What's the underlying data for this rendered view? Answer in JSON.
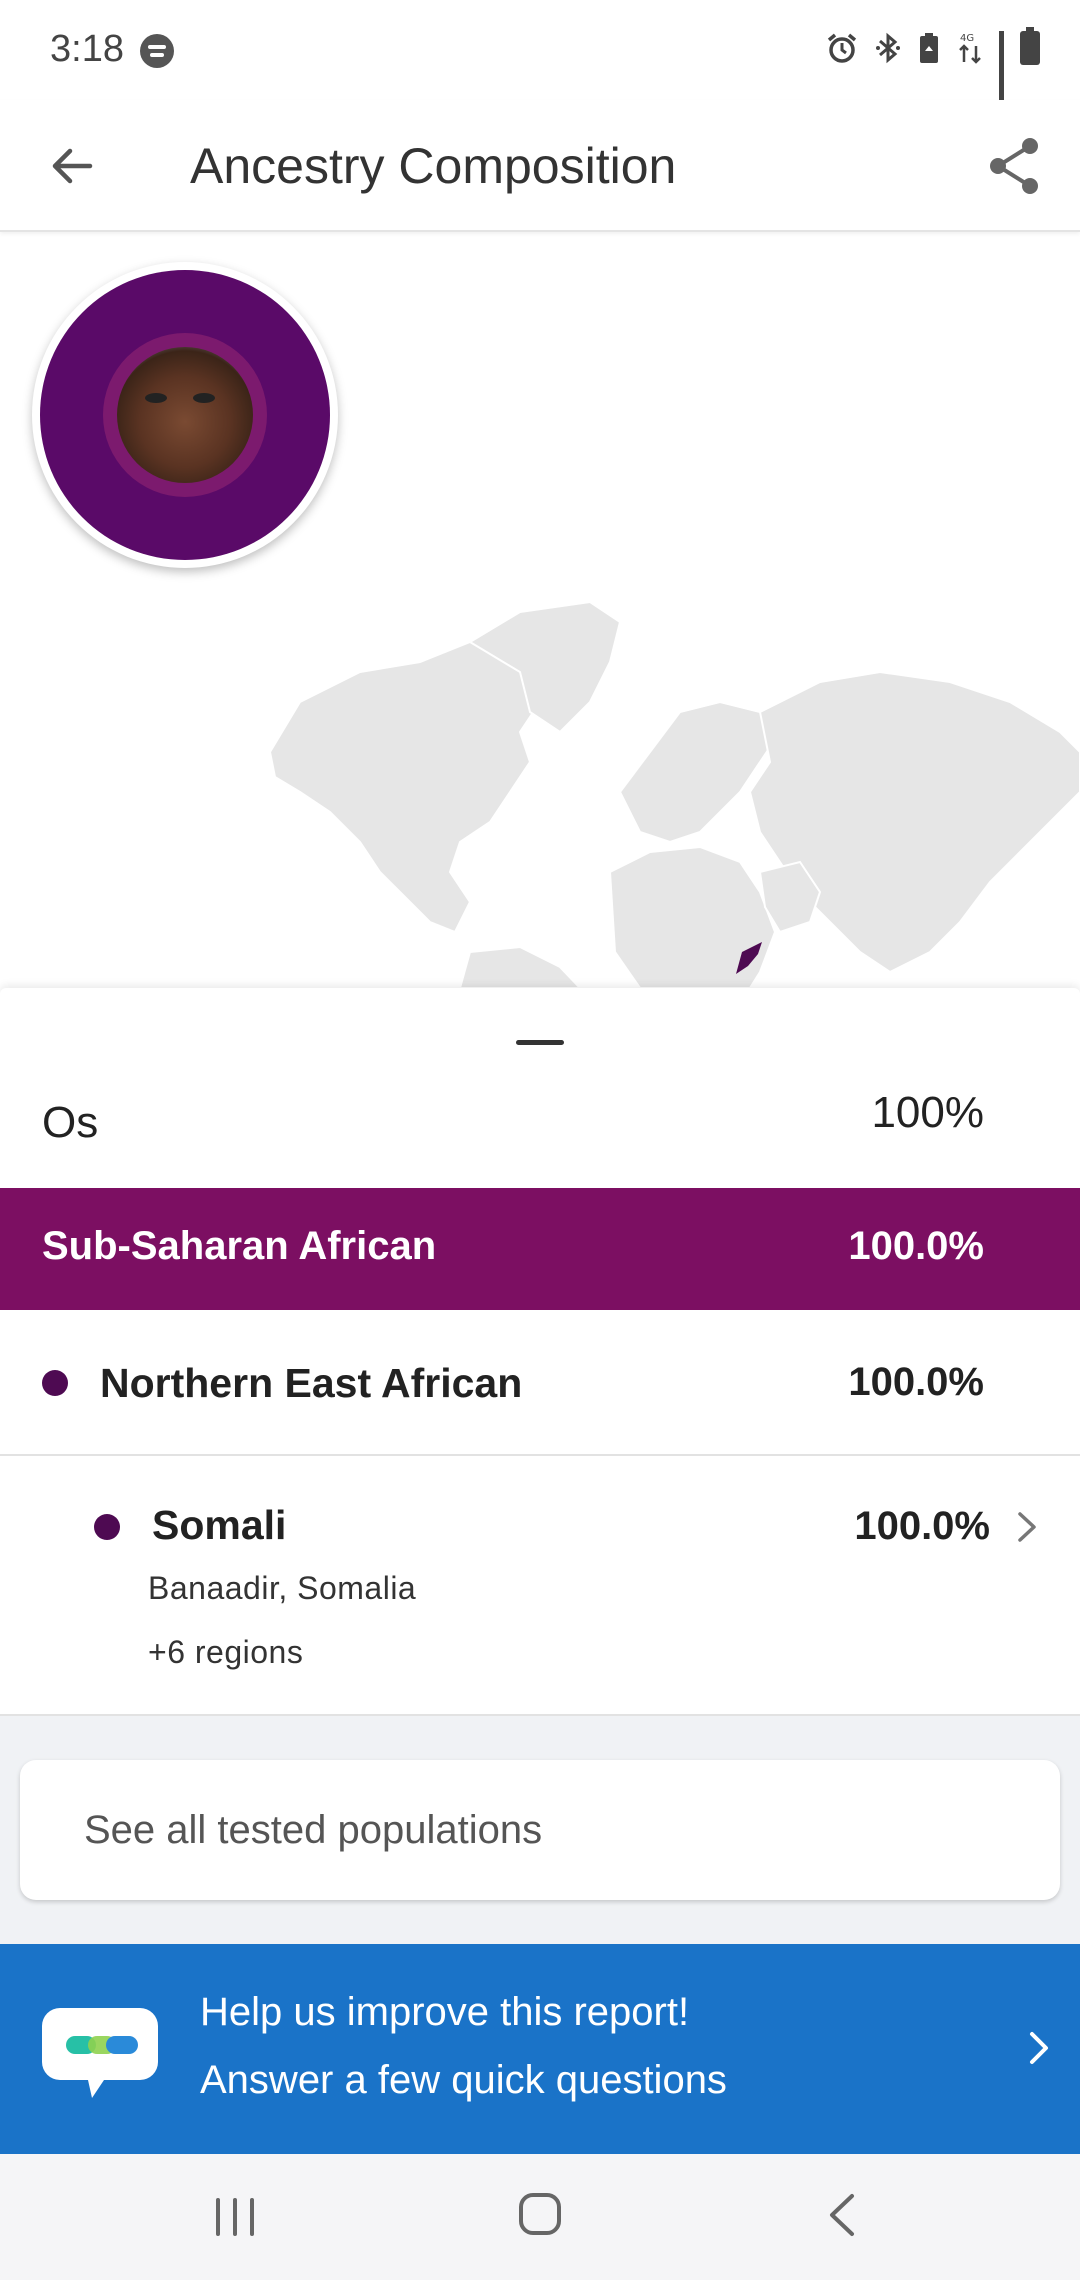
{
  "status_bar": {
    "time": "3:18",
    "app_notification_icon": "spotify-icon",
    "icons": [
      "alarm-icon",
      "bluetooth-icon",
      "battery-saver-icon",
      "lte-data-icon",
      "signal-icon",
      "battery-icon"
    ],
    "lte_label": "4G LTE"
  },
  "app_bar": {
    "title": "Ancestry Composition",
    "back_icon": "arrow-back-icon",
    "share_icon": "share-icon"
  },
  "map": {
    "highlight_color": "#4e0a52",
    "land_color": "#e6e6e6"
  },
  "sheet": {
    "summary": {
      "name": "Os",
      "percent": "100%"
    },
    "region": {
      "name": "Sub-Saharan African",
      "percent": "100.0%",
      "color": "#7c0f62"
    },
    "subregion": {
      "name": "Northern East African",
      "percent": "100.0%"
    },
    "population": {
      "name": "Somali",
      "percent": "100.0%",
      "location": "Banaadir, Somalia",
      "extra_regions": "+6 regions"
    },
    "see_all_label": "See all tested populations"
  },
  "feedback": {
    "line1": "Help us improve this report!",
    "line2": "Answer a few quick questions",
    "accent": "#1a73c8"
  },
  "nav_bar": {
    "icons": [
      "recents-icon",
      "home-icon",
      "back-nav-icon"
    ]
  }
}
